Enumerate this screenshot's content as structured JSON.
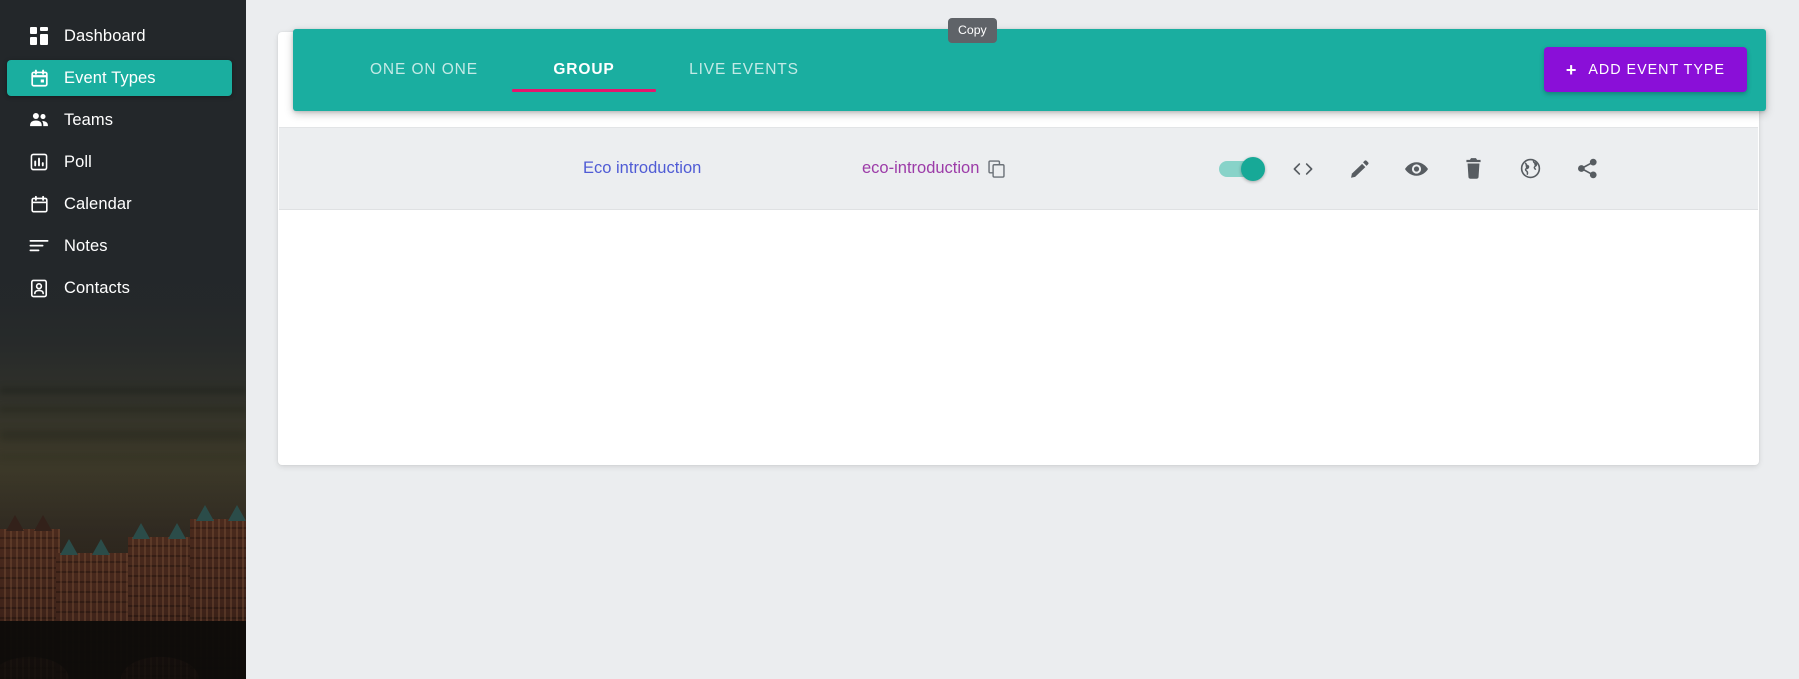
{
  "sidebar": {
    "items": [
      {
        "label": "Dashboard",
        "icon": "dashboard-icon",
        "active": false
      },
      {
        "label": "Event Types",
        "icon": "calendar-event-icon",
        "active": true
      },
      {
        "label": "Teams",
        "icon": "people-icon",
        "active": false
      },
      {
        "label": "Poll",
        "icon": "bar-chart-icon",
        "active": false
      },
      {
        "label": "Calendar",
        "icon": "calendar-icon",
        "active": false
      },
      {
        "label": "Notes",
        "icon": "notes-icon",
        "active": false
      },
      {
        "label": "Contacts",
        "icon": "contact-card-icon",
        "active": false
      }
    ],
    "active_color": "#1aae9f",
    "background_color": "#23272a"
  },
  "topbar": {
    "background_color": "#1aaea0",
    "active_underline_color": "#e6156d",
    "tabs": [
      {
        "label": "ONE ON ONE",
        "active": false
      },
      {
        "label": "GROUP",
        "active": true
      },
      {
        "label": "LIVE EVENTS",
        "active": false
      }
    ],
    "add_button": {
      "label": "ADD EVENT TYPE",
      "plus": "+",
      "color": "#8a0fd8"
    }
  },
  "tooltip": {
    "text": "Copy"
  },
  "event_row": {
    "title": "Eco introduction",
    "title_color": "#4f5bd5",
    "slug": "eco-introduction",
    "slug_color": "#9c3ba8",
    "copy_icon": "copy-icon",
    "toggle": {
      "name": "enabled-toggle",
      "state": "on",
      "on_color": "#17a997"
    },
    "actions": [
      {
        "name": "embed-code-icon",
        "title": "<>"
      },
      {
        "name": "edit-pencil-icon",
        "title": "edit"
      },
      {
        "name": "preview-eye-icon",
        "title": "preview"
      },
      {
        "name": "delete-trash-icon",
        "title": "delete"
      },
      {
        "name": "globe-icon",
        "title": "globe"
      },
      {
        "name": "share-icon",
        "title": "share"
      }
    ]
  }
}
